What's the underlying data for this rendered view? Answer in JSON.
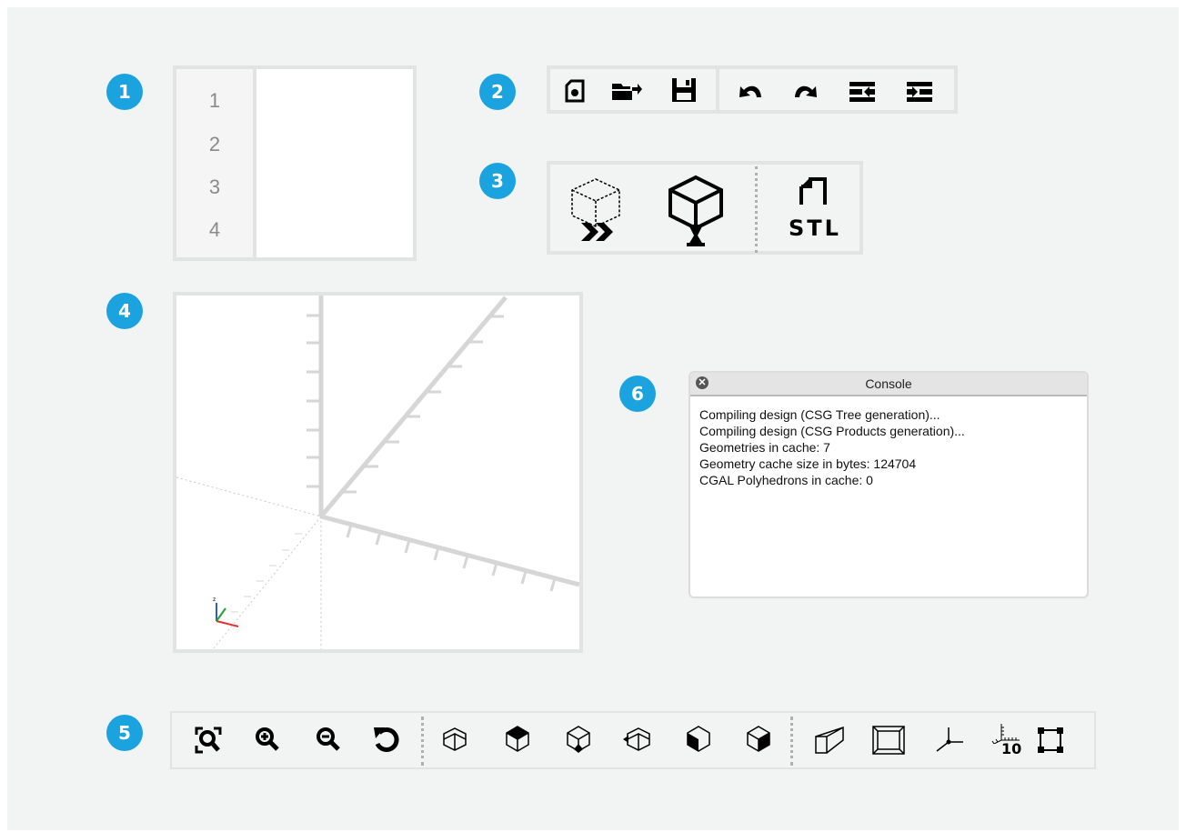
{
  "badges": [
    "1",
    "2",
    "3",
    "4",
    "5",
    "6"
  ],
  "editor": {
    "line_numbers": [
      "1",
      "2",
      "3",
      "4"
    ]
  },
  "file_toolbar": {
    "file_icons": [
      "new-file-icon",
      "open-folder-icon",
      "save-icon"
    ],
    "edit_icons": [
      "undo-icon",
      "redo-icon",
      "unindent-icon",
      "indent-icon"
    ]
  },
  "design_toolbar": {
    "icons": [
      "preview-icon",
      "render-icon",
      "export-stl-icon"
    ],
    "stl_label": "STL"
  },
  "view_toolbar": {
    "icons": [
      "view-all-icon",
      "zoom-in-icon",
      "zoom-out-icon",
      "reset-view-icon",
      "view-right-icon",
      "view-top-icon",
      "view-bottom-icon",
      "view-left-icon",
      "view-front-icon",
      "view-back-icon",
      "perspective-icon",
      "orthogonal-icon",
      "show-axes-icon",
      "show-scale-markers-icon",
      "show-edges-icon"
    ],
    "scale_label": "10"
  },
  "console": {
    "title": "Console",
    "lines": [
      "Compiling design (CSG Tree generation)...",
      "Compiling design (CSG Products generation)...",
      "Geometries in cache: 7",
      "Geometry cache size in bytes: 124704",
      "CGAL Polyhedrons in cache: 0"
    ]
  },
  "colors": {
    "accent": "#1aa3de",
    "panel_border": "#e2e3e3",
    "background": "#f2f3f3",
    "axis_x": "#e03030",
    "axis_y": "#2aa02a",
    "axis_z": "#2d5bd8"
  }
}
